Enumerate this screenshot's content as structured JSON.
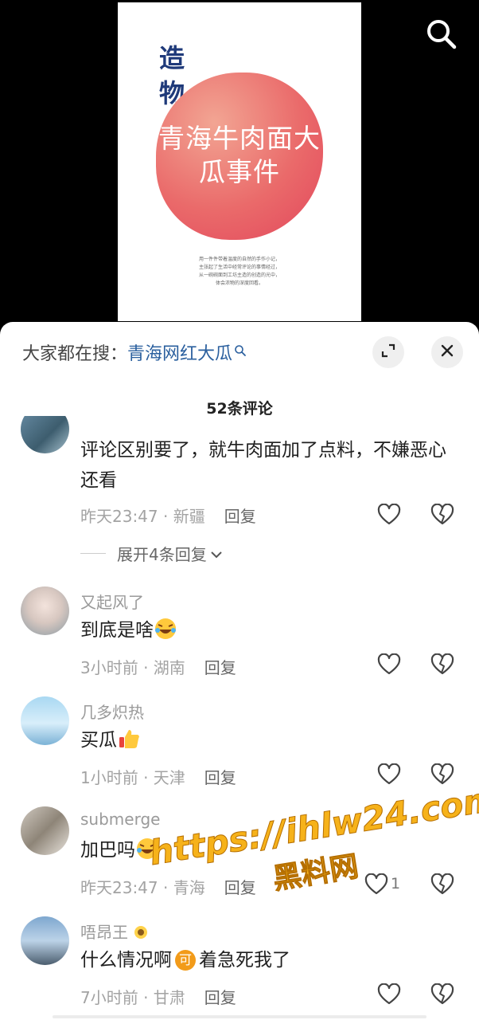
{
  "poster": {
    "brand": "造物",
    "title": "青海牛肉面大瓜事件",
    "desc_lines": [
      "用一件件带着温度的自然的手作小记，",
      "主张起了生活中经常评论的事情经过，",
      "从一碗碗面到工坊主造的创造的光中，",
      "体会浓物的深度回看。"
    ]
  },
  "everyone_search": {
    "prefix": "大家都在搜：",
    "keyword": "青海网红大瓜"
  },
  "comment_count": "52条评论",
  "comments": [
    {
      "username": "",
      "text": "评论区别要了，就牛肉面加了点料，不嫌恶心还看",
      "time_loc": "昨天23:47 · 新疆",
      "reply": "回复",
      "likes": "",
      "expand": "展开4条回复"
    },
    {
      "username": "又起风了",
      "text": "到底是啥",
      "emoji": "laugh-cry-emoji",
      "time_loc": "3小时前 · 湖南",
      "reply": "回复",
      "likes": ""
    },
    {
      "username": "几多炽热",
      "text": "买瓜",
      "emoji": "thumbs-up-emoji",
      "time_loc": "1小时前 · 天津",
      "reply": "回复",
      "likes": ""
    },
    {
      "username": "submerge",
      "text": "加巴吗",
      "emoji": "laugh-cry-emoji",
      "time_loc": "昨天23:47 · 青海",
      "reply": "回复",
      "likes": "1"
    },
    {
      "username": "唔昂王",
      "text_before": "什么情况啊",
      "badge": "可",
      "text_after": "着急死我了",
      "time_loc": "7小时前 · 甘肃",
      "reply": "回复",
      "likes": ""
    }
  ],
  "watermark": {
    "url": "https://ihlw24.com",
    "name": "黑料网"
  },
  "colors": {
    "keyword": "#2a5f9e",
    "accent": "#f6b21a",
    "blob": "#e2475c"
  },
  "icons": [
    "search-icon",
    "search-small-icon",
    "expand-icon",
    "close-icon",
    "heart-icon",
    "broken-heart-icon",
    "chevron-down-icon",
    "sunflower-icon"
  ]
}
